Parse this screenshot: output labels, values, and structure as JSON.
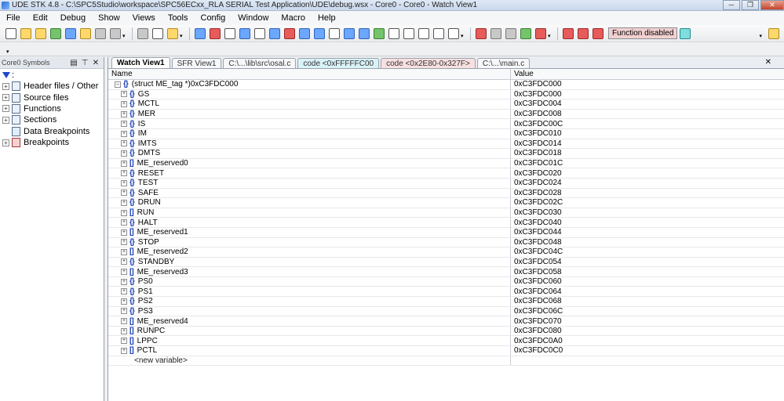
{
  "window": {
    "title": "UDE STK 4.8 - C:\\SPC5Studio\\workspace\\SPC56ECxx_RLA SERIAL Test Application\\UDE\\debug.wsx - Core0 - Core0 - Watch View1"
  },
  "menubar": [
    "File",
    "Edit",
    "Debug",
    "Show",
    "Views",
    "Tools",
    "Config",
    "Window",
    "Macro",
    "Help"
  ],
  "toolbar": {
    "function_status": "Function disabled"
  },
  "left_panel": {
    "title": "Core0 Symbols",
    "filter_label": ":",
    "items": [
      {
        "label": "Header files / Other",
        "icon": "file-icon"
      },
      {
        "label": "Source files",
        "icon": "file-icon"
      },
      {
        "label": "Functions",
        "icon": "file-icon"
      },
      {
        "label": "Sections",
        "icon": "file-icon"
      },
      {
        "label": "Data Breakpoints",
        "icon": "data-breakpoint-icon"
      },
      {
        "label": "Breakpoints",
        "icon": "breakpoint-icon"
      }
    ]
  },
  "tabs": [
    {
      "label": "Watch View1",
      "active": true
    },
    {
      "label": "SFR View1",
      "active": false
    },
    {
      "label": "C:\\...\\lib\\src\\osal.c",
      "active": false
    },
    {
      "label": "code <0xFFFFFC00",
      "active": false
    },
    {
      "label": "code <0x2E80-0x327F>",
      "active": false
    },
    {
      "label": "C:\\...\\main.c",
      "active": false
    }
  ],
  "watch": {
    "columns": [
      "Name",
      "Value"
    ],
    "root": {
      "name": "(struct ME_tag *)0xC3FDC000",
      "value": "0xC3FDC000",
      "icon": "{}"
    },
    "children": [
      {
        "name": "GS",
        "value": "0xC3FDC000",
        "icon": "{}"
      },
      {
        "name": "MCTL",
        "value": "0xC3FDC004",
        "icon": "{}"
      },
      {
        "name": "MER",
        "value": "0xC3FDC008",
        "icon": "{}"
      },
      {
        "name": "IS",
        "value": "0xC3FDC00C",
        "icon": "{}"
      },
      {
        "name": "IM",
        "value": "0xC3FDC010",
        "icon": "{}"
      },
      {
        "name": "IMTS",
        "value": "0xC3FDC014",
        "icon": "{}"
      },
      {
        "name": "DMTS",
        "value": "0xC3FDC018",
        "icon": "{}"
      },
      {
        "name": "ME_reserved0",
        "value": "0xC3FDC01C",
        "icon": "[]"
      },
      {
        "name": "RESET",
        "value": "0xC3FDC020",
        "icon": "{}"
      },
      {
        "name": "TEST",
        "value": "0xC3FDC024",
        "icon": "{}"
      },
      {
        "name": "SAFE",
        "value": "0xC3FDC028",
        "icon": "{}"
      },
      {
        "name": "DRUN",
        "value": "0xC3FDC02C",
        "icon": "{}"
      },
      {
        "name": "RUN",
        "value": "0xC3FDC030",
        "icon": "[]"
      },
      {
        "name": "HALT",
        "value": "0xC3FDC040",
        "icon": "{}"
      },
      {
        "name": "ME_reserved1",
        "value": "0xC3FDC044",
        "icon": "[]"
      },
      {
        "name": "STOP",
        "value": "0xC3FDC048",
        "icon": "{}"
      },
      {
        "name": "ME_reserved2",
        "value": "0xC3FDC04C",
        "icon": "[]"
      },
      {
        "name": "STANDBY",
        "value": "0xC3FDC054",
        "icon": "{}"
      },
      {
        "name": "ME_reserved3",
        "value": "0xC3FDC058",
        "icon": "[]"
      },
      {
        "name": "PS0",
        "value": "0xC3FDC060",
        "icon": "{}"
      },
      {
        "name": "PS1",
        "value": "0xC3FDC064",
        "icon": "{}"
      },
      {
        "name": "PS2",
        "value": "0xC3FDC068",
        "icon": "{}"
      },
      {
        "name": "PS3",
        "value": "0xC3FDC06C",
        "icon": "{}"
      },
      {
        "name": "ME_reserved4",
        "value": "0xC3FDC070",
        "icon": "[]"
      },
      {
        "name": "RUNPC",
        "value": "0xC3FDC080",
        "icon": "[]"
      },
      {
        "name": "LPPC",
        "value": "0xC3FDC0A0",
        "icon": "[]"
      },
      {
        "name": "PCTL",
        "value": "0xC3FDC0C0",
        "icon": "[]"
      }
    ],
    "new_variable": "<new variable>"
  }
}
